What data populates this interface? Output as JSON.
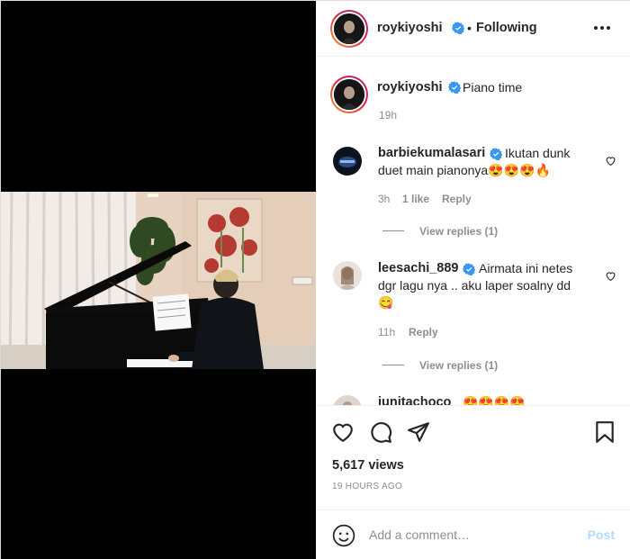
{
  "post": {
    "username": "roykiyoshi",
    "follow_status": "Following",
    "separator": "•",
    "caption": "Piano time",
    "caption_time": "19h"
  },
  "comments": [
    {
      "username": "barbiekumalasari",
      "text_line1": "Ikutan dunk",
      "text_line2": "duet main pianonya😍😍😍🔥",
      "time": "3h",
      "likes": "1 like",
      "reply": "Reply",
      "view_replies": "View replies (1)"
    },
    {
      "username": "leesachi_889",
      "text_line1": "Airmata ini netes",
      "text_line2": "dgr lagu nya .. aku laper soalny dd",
      "text_line3": "😋",
      "time": "11h",
      "reply": "Reply",
      "view_replies": "View replies (1)"
    },
    {
      "username": "junitachoco",
      "text_line1": "😍😍😍😍"
    }
  ],
  "engagement": {
    "views": "5,617 views",
    "posted": "19 HOURS AGO"
  },
  "composer": {
    "placeholder": "Add a comment…",
    "post_label": "Post"
  },
  "colors": {
    "verified": "#3897f0",
    "post_button_disabled": "#b3dbff",
    "meta_gray": "#8e8e8e"
  },
  "icons": [
    "verified-badge-icon",
    "more-options-icon",
    "heart-icon",
    "comment-icon",
    "share-icon",
    "bookmark-icon",
    "emoji-icon"
  ]
}
